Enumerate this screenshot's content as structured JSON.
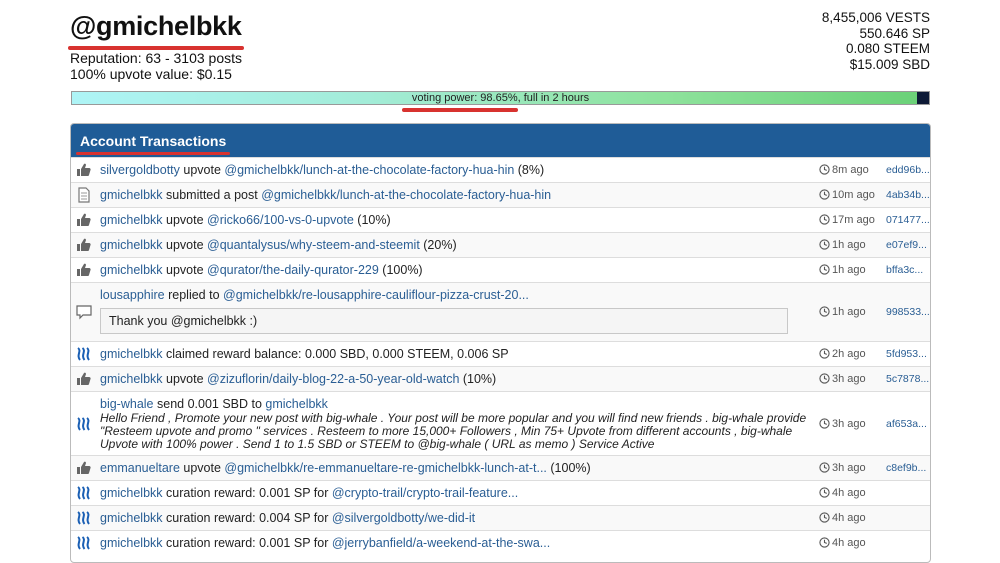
{
  "account": {
    "username": "@gmichelbkk",
    "reputation": "Reputation: 63 - 3103 posts",
    "upvote_value": "100% upvote value: $0.15"
  },
  "stats": {
    "vests": "8,455,006 VESTS",
    "sp": "550.646 SP",
    "steem": "0.080 STEEM",
    "sbd": "$15.009 SBD"
  },
  "voting_power": {
    "label": "voting power: 98.65%, full in 2 hours",
    "percent": 98.65
  },
  "panel": {
    "title": "Account Transactions"
  },
  "colors": {
    "header": "#1f5c97",
    "link": "#2a5e94",
    "highlight": "#d8322f"
  },
  "transactions": [
    {
      "icon": "thumbs-up-icon",
      "actor": "silvergoldbotty",
      "action": " upvote ",
      "target": "@gmichelbkk/lunch-at-the-chocolate-factory-hua-hin",
      "suffix": " (8%)",
      "time": "8m ago",
      "hash": "edd96b..."
    },
    {
      "icon": "document-icon",
      "actor": "gmichelbkk",
      "action": " submitted a post ",
      "target": "@gmichelbkk/lunch-at-the-chocolate-factory-hua-hin",
      "suffix": "",
      "time": "10m ago",
      "hash": "4ab34b..."
    },
    {
      "icon": "thumbs-up-icon",
      "actor": "gmichelbkk",
      "action": " upvote ",
      "target": "@ricko66/100-vs-0-upvote",
      "suffix": " (10%)",
      "time": "17m ago",
      "hash": "071477..."
    },
    {
      "icon": "thumbs-up-icon",
      "actor": "gmichelbkk",
      "action": " upvote ",
      "target": "@quantalysus/why-steem-and-steemit",
      "suffix": " (20%)",
      "time": "1h ago",
      "hash": "e07ef9..."
    },
    {
      "icon": "thumbs-up-icon",
      "actor": "gmichelbkk",
      "action": " upvote ",
      "target": "@qurator/the-daily-qurator-229",
      "suffix": " (100%)",
      "time": "1h ago",
      "hash": "bffa3c..."
    },
    {
      "icon": "comment-icon",
      "actor": "lousapphire",
      "action": " replied to ",
      "target": "@gmichelbkk/re-lousapphire-cauliflour-pizza-crust-20...",
      "suffix": "",
      "quote": "Thank you @gmichelbkk :)",
      "time": "1h ago",
      "hash": "998533..."
    },
    {
      "icon": "steem-icon",
      "actor": "gmichelbkk",
      "action": " claimed reward balance: 0.000 SBD, 0.000 STEEM, 0.006 SP",
      "target": "",
      "suffix": "",
      "time": "2h ago",
      "hash": "5fd953..."
    },
    {
      "icon": "thumbs-up-icon",
      "actor": "gmichelbkk",
      "action": " upvote ",
      "target": "@zizuflorin/daily-blog-22-a-50-year-old-watch",
      "suffix": " (10%)",
      "time": "3h ago",
      "hash": "5c7878..."
    },
    {
      "icon": "steem-icon",
      "actor": "big-whale",
      "action": " send 0.001 SBD to ",
      "target": "gmichelbkk",
      "suffix": "",
      "memo": "Hello Friend , Promote your new post with big-whale . Your post will be more popular and you will find new friends . big-whale provide \"Resteem upvote and promo \" services . Resteem to more 15,000+ Followers , Min 75+ Upvote from different accounts , big-whale Upvote with 100% power . Send 1 to 1.5 SBD or STEEM to @big-whale ( URL as memo ) Service Active",
      "time": "3h ago",
      "hash": "af653a..."
    },
    {
      "icon": "thumbs-up-icon",
      "actor": "emmanueltare",
      "action": " upvote ",
      "target": "@gmichelbkk/re-emmanueltare-re-gmichelbkk-lunch-at-t...",
      "suffix": " (100%)",
      "time": "3h ago",
      "hash": "c8ef9b..."
    },
    {
      "icon": "steem-icon",
      "actor": "gmichelbkk",
      "action": " curation reward: 0.001 SP for ",
      "target": "@crypto-trail/crypto-trail-feature...",
      "suffix": "",
      "time": "4h ago",
      "hash": ""
    },
    {
      "icon": "steem-icon",
      "actor": "gmichelbkk",
      "action": " curation reward: 0.004 SP for ",
      "target": "@silvergoldbotty/we-did-it",
      "suffix": "",
      "time": "4h ago",
      "hash": ""
    },
    {
      "icon": "steem-icon",
      "actor": "gmichelbkk",
      "action": " curation reward: 0.001 SP for ",
      "target": "@jerrybanfield/a-weekend-at-the-swa...",
      "suffix": "",
      "time": "4h ago",
      "hash": ""
    }
  ]
}
